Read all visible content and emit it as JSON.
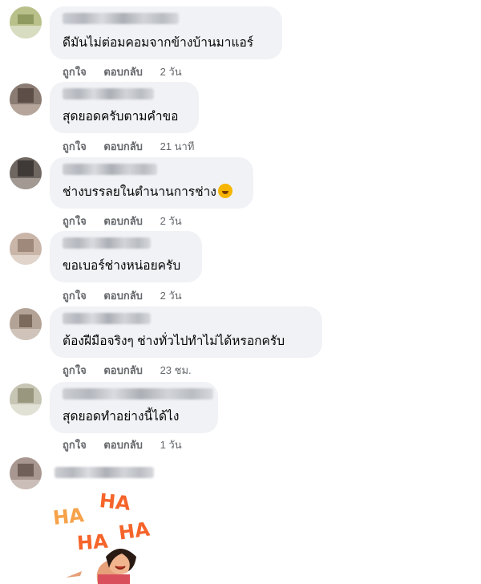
{
  "comments": [
    {
      "text": "ดีมันไม่ต่อมคอมจากข้างบ้านมาแอร์",
      "like": "ถูกใจ",
      "reply": "ตอบกลับ",
      "time": "2 วัน"
    },
    {
      "text": "สุดยอดครับตามคำขอ",
      "like": "ถูกใจ",
      "reply": "ตอบกลับ",
      "time": "21 นาที"
    },
    {
      "text": "ช่างบรรลยในตำนานการช่าง",
      "like": "ถูกใจ",
      "reply": "ตอบกลับ",
      "time": "2 วัน"
    },
    {
      "text": "ขอเบอร์ช่างหน่อยครับ",
      "like": "ถูกใจ",
      "reply": "ตอบกลับ",
      "time": "2 วัน"
    },
    {
      "text": "ต้องฝีมือจริงๆ ช่างทั่วไปทำไม่ได้หรอกครับ",
      "like": "ถูกใจ",
      "reply": "ตอบกลับ",
      "time": "23 ชม."
    },
    {
      "text": "สุดยอดทำอย่างนี้ได้ไง",
      "like": "ถูกใจ",
      "reply": "ตอบกลับ",
      "time": "1 วัน"
    }
  ],
  "sticker": {
    "words": [
      "HA",
      "HA",
      "HA",
      "HA"
    ]
  },
  "colors": {
    "bubble": "#f0f2f5",
    "meta": "#65676b",
    "text": "#050505",
    "sticker_ha": "#f5642a"
  },
  "icons": {
    "emoji": "rofl-emoji-icon"
  }
}
